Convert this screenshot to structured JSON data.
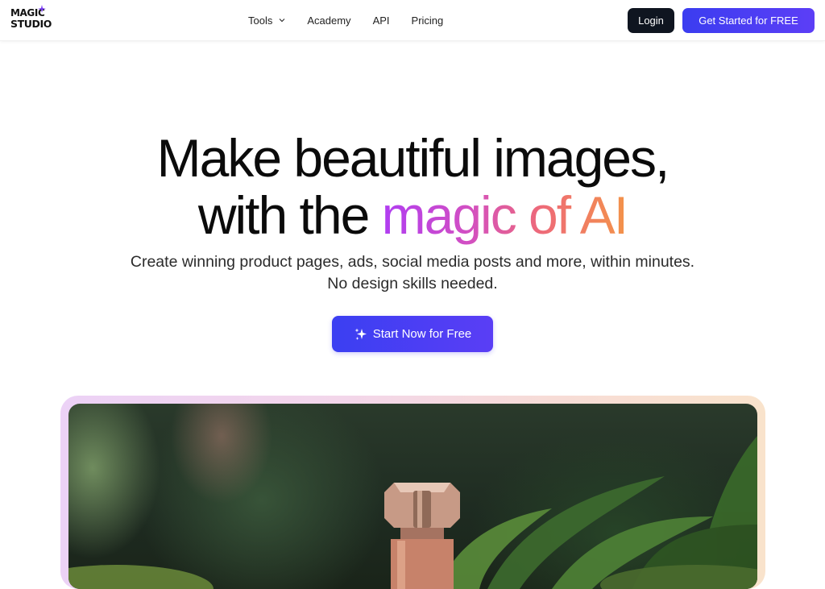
{
  "logo": {
    "line1": "MAGIC",
    "line2": "STUDIO"
  },
  "nav": {
    "links": [
      {
        "label": "Tools",
        "has_dropdown": true
      },
      {
        "label": "Academy"
      },
      {
        "label": "API"
      },
      {
        "label": "Pricing"
      }
    ],
    "login_label": "Login",
    "cta_label": "Get Started for FREE"
  },
  "hero": {
    "line1": "Make beautiful images,",
    "line2_plain": "with the ",
    "line2_gradient": "magic of AI",
    "subtitle_line1": "Create winning product pages, ads, social media posts and more, within minutes.",
    "subtitle_line2": "No design skills needed.",
    "button_label": "Start Now for Free"
  },
  "colors": {
    "primary": "#4a3ef3",
    "dark_button": "#0f1520",
    "gradient_start": "#b03df2",
    "gradient_end": "#f3934a"
  },
  "icons": {
    "logo_spark": "sparkle-icon",
    "tools_dropdown": "chevron-down-icon",
    "start_button": "sparkles-icon"
  }
}
